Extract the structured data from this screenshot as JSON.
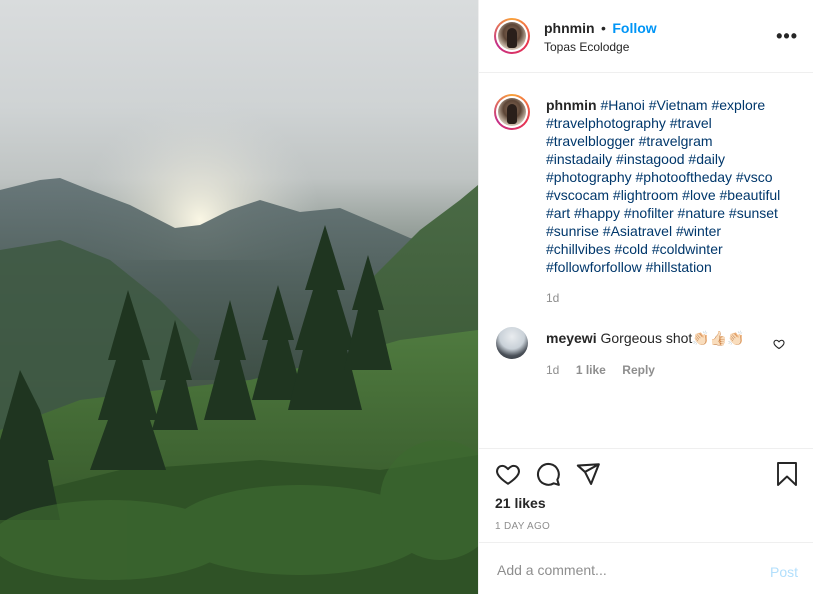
{
  "post": {
    "image": {
      "description_icon": "landscape-photo"
    },
    "header": {
      "username": "phnmin",
      "separator": "•",
      "follow_label": "Follow",
      "location": "Topas Ecolodge",
      "more_icon": "more-horizontal-icon",
      "more_label": "•••"
    },
    "caption": {
      "username": "phnmin",
      "hashtag_lines": [
        "#Hanoi #Vietnam #explore",
        "#travelphotography #travel",
        "#travelblogger #travelgram",
        "#instadaily #instagood #daily",
        "#photography #photooftheday #vsco",
        "#vscocam #lightroom #love #beautiful",
        "#art #happy #nofilter #nature #sunset",
        "#sunrise #Asiatravel #winter",
        "#chillvibes #cold #coldwinter",
        "#followforfollow #hillstation"
      ],
      "age": "1d"
    },
    "comments": [
      {
        "username": "meyewi",
        "text": "Gorgeous shot",
        "emoji": "👏🏻👍🏻👏🏻",
        "age": "1d",
        "likes_label": "1 like",
        "reply_label": "Reply"
      }
    ],
    "likes_label": "21 likes",
    "date_label": "1 DAY AGO",
    "add_comment": {
      "placeholder": "Add a comment...",
      "post_label": "Post"
    }
  },
  "colors": {
    "link_blue": "#0095f6",
    "hashtag_blue": "#00376b",
    "muted_gray": "#8e8e8e",
    "post_disabled": "#b2dffc",
    "text": "#262626"
  }
}
